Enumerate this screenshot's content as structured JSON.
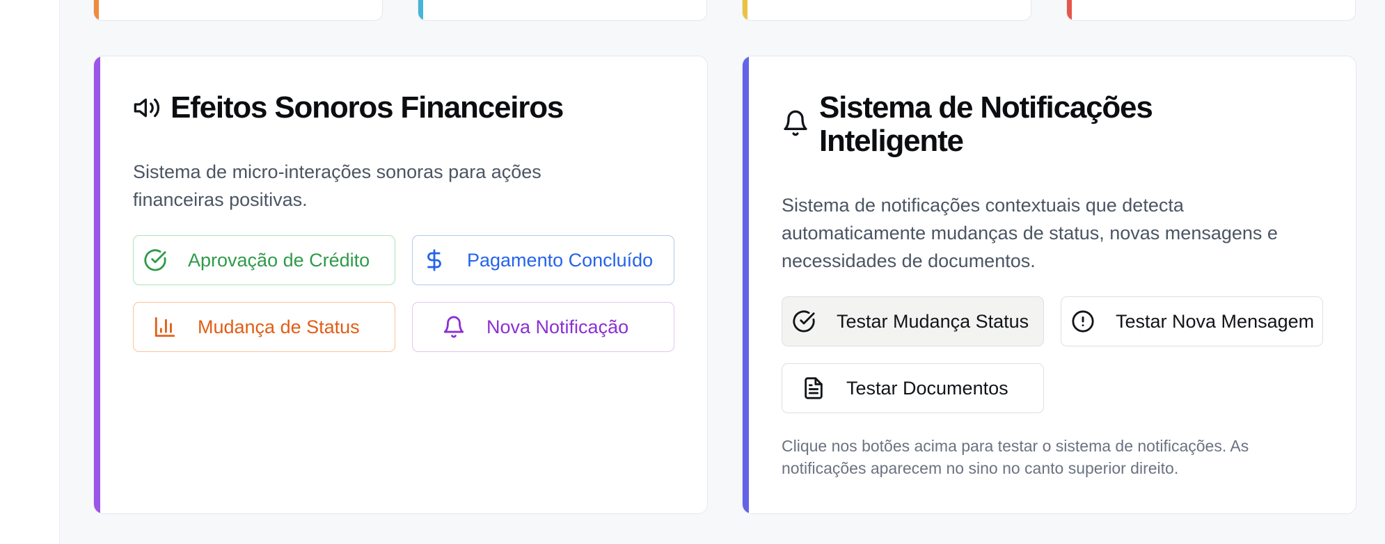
{
  "accent_colors": {
    "orange": "#f08a3c",
    "cyan": "#45b5d8",
    "yellow": "#ebc23e",
    "red": "#e5564c",
    "purple": "#9b55e8",
    "indigo": "#6363e8"
  },
  "sound_card": {
    "icon": "speaker-icon",
    "title": "Efeitos Sonoros Financeiros",
    "description": "Sistema de micro-interações sonoras para ações financeiras positivas.",
    "buttons": [
      {
        "label": "Aprovação de Crédito",
        "icon": "check-circle-icon",
        "color": "#2f9a4a"
      },
      {
        "label": "Pagamento Concluído",
        "icon": "dollar-icon",
        "color": "#2563eb"
      },
      {
        "label": "Mudança de Status",
        "icon": "bar-chart-icon",
        "color": "#e25d15"
      },
      {
        "label": "Nova Notificação",
        "icon": "bell-icon",
        "color": "#8b2fd6"
      }
    ]
  },
  "notification_card": {
    "icon": "bell-icon",
    "title": "Sistema de Notificações Inteligente",
    "description": "Sistema de notificações contextuais que detecta automaticamente mudanças de status, novas mensagens e necessidades de documentos.",
    "buttons": [
      {
        "label": "Testar Mudança Status",
        "icon": "check-circle-icon"
      },
      {
        "label": "Testar Nova Mensagem",
        "icon": "alert-circle-icon"
      },
      {
        "label": "Testar Documentos",
        "icon": "file-text-icon"
      }
    ],
    "note": "Clique nos botões acima para testar o sistema de notificações. As notificações aparecem no sino no canto superior direito."
  }
}
